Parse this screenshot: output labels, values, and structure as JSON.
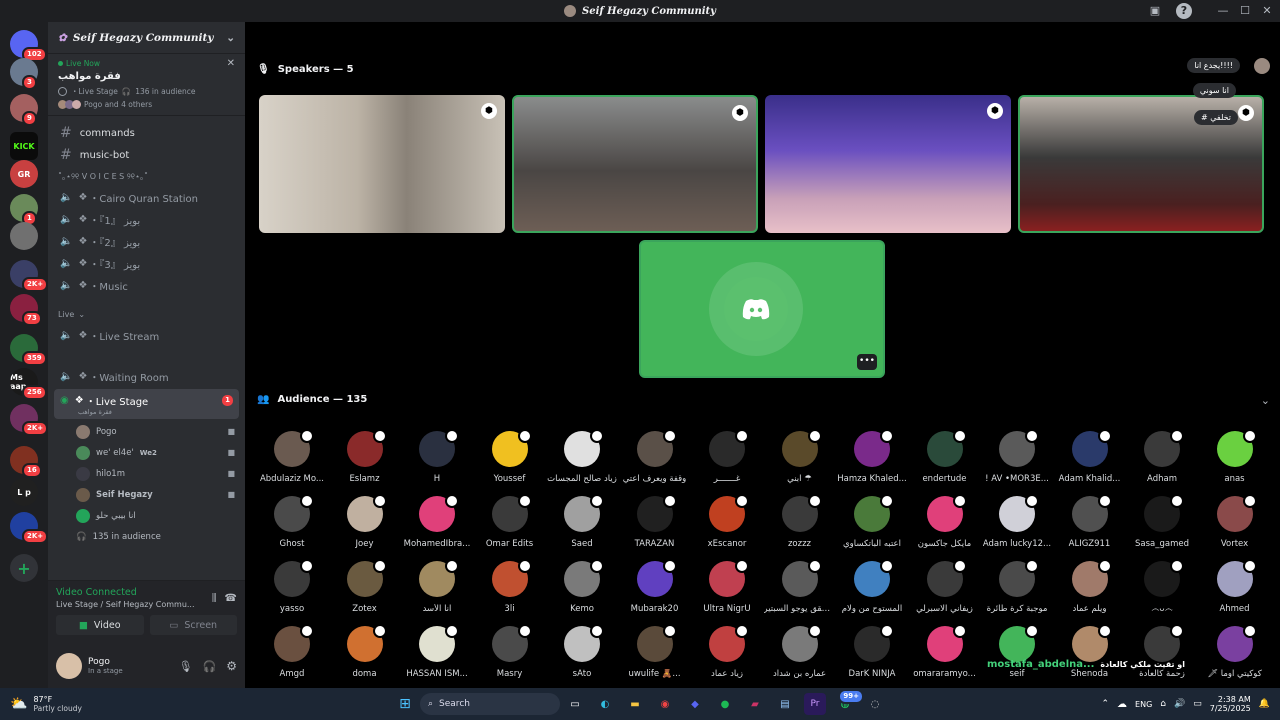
{
  "window": {
    "title": "Seif Hegazy Community"
  },
  "guilds": [
    {
      "badge": "102",
      "color": "#5865f2"
    },
    {
      "badge": "3",
      "color": "#6a7a90"
    },
    {
      "badge": "9",
      "color": "#a46060"
    },
    {
      "label": "KICK",
      "color": "#0b0b0b",
      "text_color": "#53fc18"
    },
    {
      "label": "GR",
      "color": "#c84040"
    },
    {
      "badge": "1",
      "color": "#6a8a5a"
    },
    {
      "color": "#707070"
    },
    {
      "badge": "2K+",
      "color": "#3a3f66"
    },
    {
      "badge": "73",
      "color": "#8a2040"
    },
    {
      "badge": "359",
      "color": "#2a6a3a"
    },
    {
      "badge": "256",
      "label": "Ms aap",
      "color": "#1a1a1a"
    },
    {
      "badge": "2K+",
      "color": "#703060"
    },
    {
      "badge": "16",
      "color": "#803020"
    },
    {
      "label": "L p",
      "color": "#202020"
    },
    {
      "badge": "2K+",
      "color": "#2040a0"
    }
  ],
  "sidebar": {
    "server_name": "Seif Hegazy Community",
    "live_now": "Live Now",
    "stage_title": "فقرة مواهب",
    "stage_meta": "・Live Stage",
    "stage_audience": "136 in audience",
    "stage_people": "Pogo and 4 others",
    "channels": [
      {
        "name": "commands"
      },
      {
        "name": "music-bot"
      }
    ],
    "voices_category": "˚｡⋆୨୧ V O I C E S ୨୧⋆｡˚",
    "voice_channels": [
      {
        "name": "・Cairo Quran Station"
      },
      {
        "name": "・『1』 بويز"
      },
      {
        "name": "・『2』 بويز"
      },
      {
        "name": "・『3』 بويز"
      },
      {
        "name": "・Music"
      }
    ],
    "live_category": "Live",
    "live_channels": [
      {
        "name": "・Live Stream"
      },
      {
        "name": "・Waiting Room"
      }
    ],
    "active_stage": "・Live Stage",
    "active_stage_sub": "فقرة مواهب",
    "active_badge": "1",
    "stage_users": [
      {
        "name": "Pogo"
      },
      {
        "name": "we' el4e'",
        "extra": "We2"
      },
      {
        "name": "hilo1m"
      },
      {
        "name": "Seif Hegazy"
      },
      {
        "name": "انا بيبي حلو"
      }
    ],
    "in_audience": "135 in audience"
  },
  "voice": {
    "connected": "Video Connected",
    "channel": "Live Stage / Seif Hegazy Commu...",
    "video_btn": "Video",
    "screen_btn": "Screen"
  },
  "user": {
    "name": "Pogo",
    "status": "In a stage"
  },
  "main": {
    "speakers_title": "Speakers — 5",
    "audience_title": "Audience — 135",
    "chat": [
      "يجدع انا!!!!",
      "انا سوني",
      "# تخلفي"
    ],
    "audience": [
      "Abdulaziz Mo...",
      "Eslamz",
      "H",
      "Youssef",
      "زياد صالح المجسات",
      "وقفة ويعرف اعتي",
      "غـــــــر",
      "ابني ☂",
      "Hamza Khaled...",
      "endertude",
      "! AV •MOR3E...",
      "Adam Khalid...",
      "Adham",
      "anas",
      "Ghost",
      "Joey",
      "MohamedIbra...",
      "Omar Edits",
      "Saed",
      "TARAZAN",
      "xEscanor",
      "zozzz",
      "اعتبه الباتكساوي",
      "مايكل جاكسون",
      "Adam lucky12...",
      "ALIGZ911",
      "Sasa_gamed",
      "Vortex",
      "yasso",
      "Zotex",
      "انا الأسد",
      "3li",
      "Kemo",
      "Mubarak20",
      "Ultra NigrU",
      "المحقق يوجو السبتير",
      "المستوح من ولام",
      "زيفاني الاسبرلي",
      "موجبة كرة طائرة",
      "ويلم عماد",
      "෴ᴗ෴",
      "Ahmed",
      "Amgd",
      "doma",
      "HASSAN ISM...",
      "Masry",
      "sAto",
      "uwulife 🧸...",
      "زياد عماد",
      "عماره بن شداد",
      "DarK NINJA",
      "omararamyo...",
      "seif",
      "Shenoda",
      "زحمة كالعادة",
      "🗡 كوكيتي اوما"
    ],
    "overlay_text": "mostafa_abdelna...",
    "overlay_text2": "او تقيت ملكي كالعادة"
  },
  "taskbar": {
    "weather_temp": "87°F",
    "weather_desc": "Partly cloudy",
    "search": "Search",
    "lang": "ENG",
    "time": "2:38 AM",
    "date": "7/25/2025",
    "chat_badge": "99+"
  },
  "colors": {
    "speaking_border": "#3ba55c",
    "discord_green": "#43b55a",
    "blurple": "#5865f2"
  }
}
